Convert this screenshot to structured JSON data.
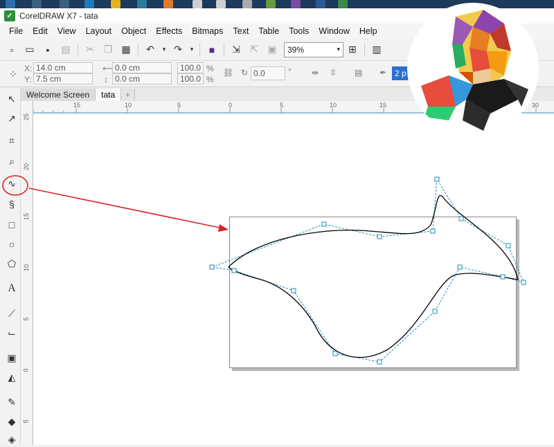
{
  "window": {
    "title": "CorelDRAW X7 - tata"
  },
  "menu": [
    "File",
    "Edit",
    "View",
    "Layout",
    "Object",
    "Effects",
    "Bitmaps",
    "Text",
    "Table",
    "Tools",
    "Window",
    "Help"
  ],
  "toolbar": {
    "zoom_value": "39%"
  },
  "property_bar": {
    "x_label": "X:",
    "x_value": "14.0 cm",
    "y_label": "Y:",
    "y_value": "7.5 cm",
    "w_value": "0.0 cm",
    "h_value": "0.0 cm",
    "scale_x": "100.0",
    "scale_y": "100.0",
    "pct1": "%",
    "pct2": "%",
    "angle_value": "0.0",
    "degree": "°",
    "outline_value": "2 p"
  },
  "tabs": [
    "Welcome Screen",
    "tata"
  ],
  "ruler_h": [
    "15",
    "10",
    "5",
    "0",
    "5",
    "10",
    "15",
    "20",
    "25",
    "30"
  ],
  "ruler_v": [
    "25",
    "20",
    "15",
    "10",
    "5",
    "0",
    "5"
  ],
  "colors": {
    "accent_red": "#d9232a",
    "node_blue": "#1a8fb3",
    "ruler_highlight": "#5aa9d6"
  }
}
